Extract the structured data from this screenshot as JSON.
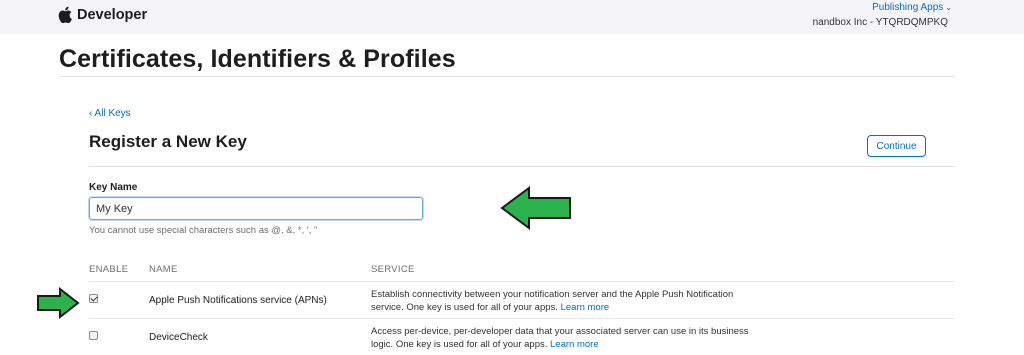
{
  "header": {
    "brand": "Developer",
    "team_menu": "Publishing Apps",
    "team_name": "nandbox Inc - YTQRDQMPKQ"
  },
  "page": {
    "title": "Certificates, Identifiers & Profiles",
    "back_link": "‹ All Keys",
    "section_title": "Register a New Key",
    "continue_label": "Continue"
  },
  "form": {
    "key_name_label": "Key Name",
    "key_name_value": "My Key",
    "hint": "You cannot use special characters such as @, &, *, ', \""
  },
  "table": {
    "columns": [
      "ENABLE",
      "NAME",
      "SERVICE"
    ],
    "rows": [
      {
        "enabled": true,
        "name": "Apple Push Notifications service (APNs)",
        "description": "Establish connectivity between your notification server and the Apple Push Notification service. One key is used for all of your apps.",
        "link": "Learn more"
      },
      {
        "enabled": false,
        "name": "DeviceCheck",
        "description": "Access per-device, per-developer data that your associated server can use in its business logic. One key is used for all of your apps.",
        "link": "Learn more"
      }
    ]
  },
  "colors": {
    "link": "#0070c9",
    "arrow_fill": "#2bb24c",
    "topbar_bg": "#f5f5f7"
  },
  "icons": [
    "apple-logo-icon",
    "chevron-down-icon",
    "checkbox-icon",
    "green-arrow-icon"
  ]
}
